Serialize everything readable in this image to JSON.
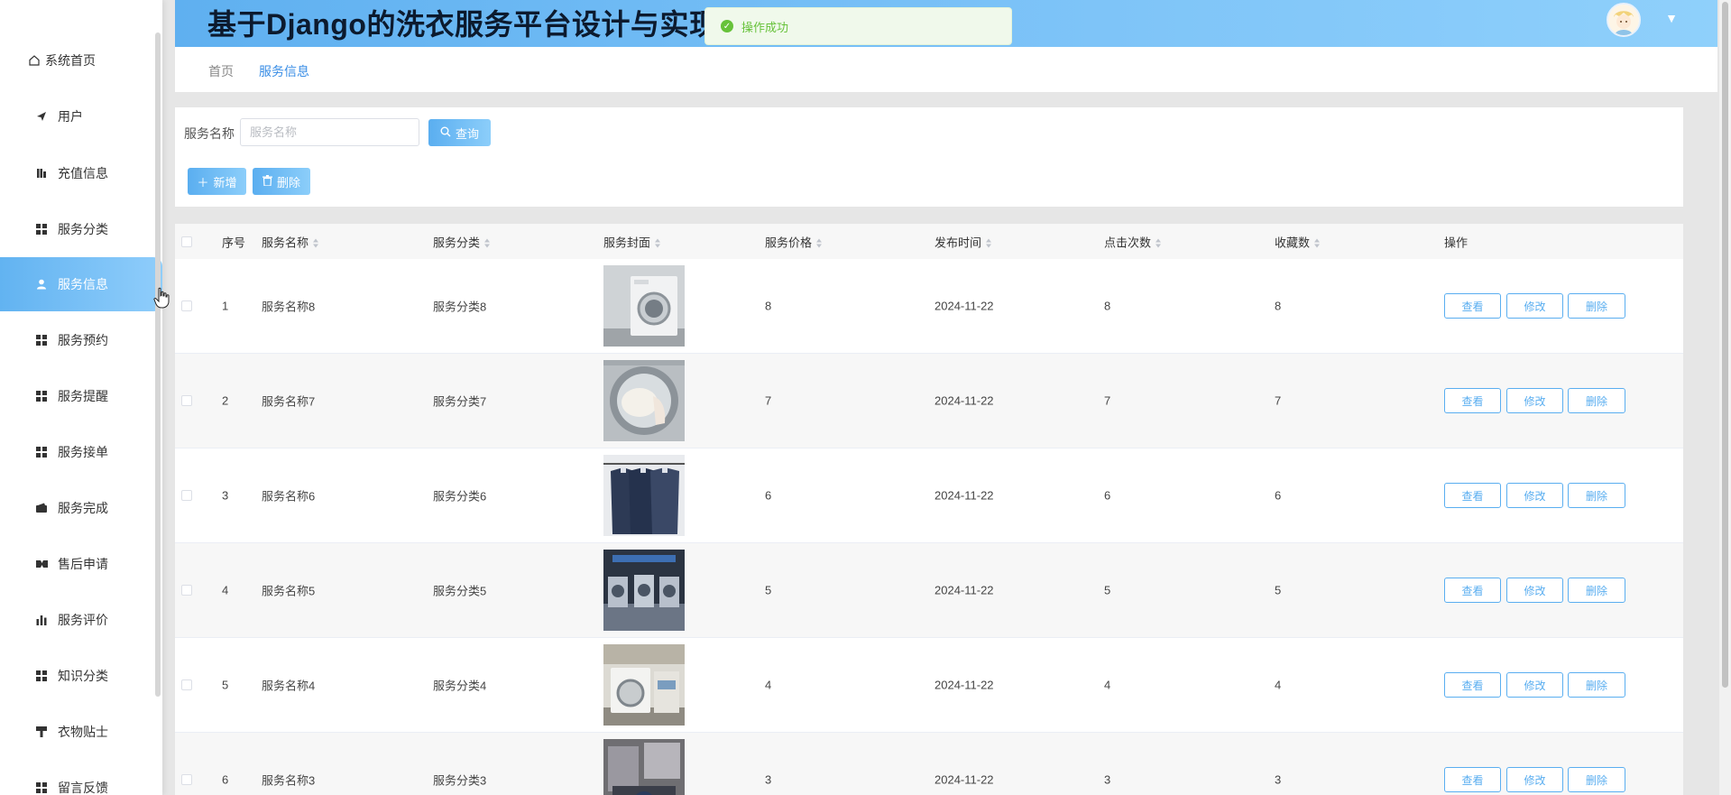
{
  "header": {
    "title": "基于Django的洗衣服务平台设计与实现"
  },
  "toast": {
    "message": "操作成功"
  },
  "sidebar": {
    "items": [
      {
        "label": "系统首页",
        "icon": "home-icon"
      },
      {
        "label": "用户",
        "icon": "send-icon"
      },
      {
        "label": "充值信息",
        "icon": "columns-icon"
      },
      {
        "label": "服务分类",
        "icon": "grid-icon"
      },
      {
        "label": "服务信息",
        "icon": "user-icon",
        "active": true
      },
      {
        "label": "服务预约",
        "icon": "grid-icon"
      },
      {
        "label": "服务提醒",
        "icon": "grid-icon"
      },
      {
        "label": "服务接单",
        "icon": "grid-icon"
      },
      {
        "label": "服务完成",
        "icon": "wallet-icon"
      },
      {
        "label": "售后申请",
        "icon": "ticket-icon"
      },
      {
        "label": "服务评价",
        "icon": "bar-chart-icon"
      },
      {
        "label": "知识分类",
        "icon": "grid-icon"
      },
      {
        "label": "衣物贴士",
        "icon": "brush-icon"
      },
      {
        "label": "留言反馈",
        "icon": "grid-icon"
      }
    ]
  },
  "breadcrumb": {
    "home": "首页",
    "current": "服务信息"
  },
  "search": {
    "label": "服务名称",
    "placeholder": "服务名称",
    "button": "查询"
  },
  "actions": {
    "add": "新增",
    "delete": "删除"
  },
  "table": {
    "columns": [
      "序号",
      "服务名称",
      "服务分类",
      "服务封面",
      "服务价格",
      "发布时间",
      "点击次数",
      "收藏数",
      "操作"
    ],
    "row_actions": {
      "view": "查看",
      "edit": "修改",
      "delete": "删除"
    },
    "rows": [
      {
        "no": "1",
        "name": "服务名称8",
        "category": "服务分类8",
        "price": "8",
        "date": "2024-11-22",
        "clicks": "8",
        "favorites": "8"
      },
      {
        "no": "2",
        "name": "服务名称7",
        "category": "服务分类7",
        "price": "7",
        "date": "2024-11-22",
        "clicks": "7",
        "favorites": "7"
      },
      {
        "no": "3",
        "name": "服务名称6",
        "category": "服务分类6",
        "price": "6",
        "date": "2024-11-22",
        "clicks": "6",
        "favorites": "6"
      },
      {
        "no": "4",
        "name": "服务名称5",
        "category": "服务分类5",
        "price": "5",
        "date": "2024-11-22",
        "clicks": "5",
        "favorites": "5"
      },
      {
        "no": "5",
        "name": "服务名称4",
        "category": "服务分类4",
        "price": "4",
        "date": "2024-11-22",
        "clicks": "4",
        "favorites": "4"
      },
      {
        "no": "6",
        "name": "服务名称3",
        "category": "服务分类3",
        "price": "3",
        "date": "2024-11-22",
        "clicks": "3",
        "favorites": "3"
      }
    ]
  },
  "colors": {
    "accent": "#5aaef0",
    "header_start": "#5fb0f0",
    "header_end": "#8fd0fb",
    "success": "#67c23a"
  }
}
